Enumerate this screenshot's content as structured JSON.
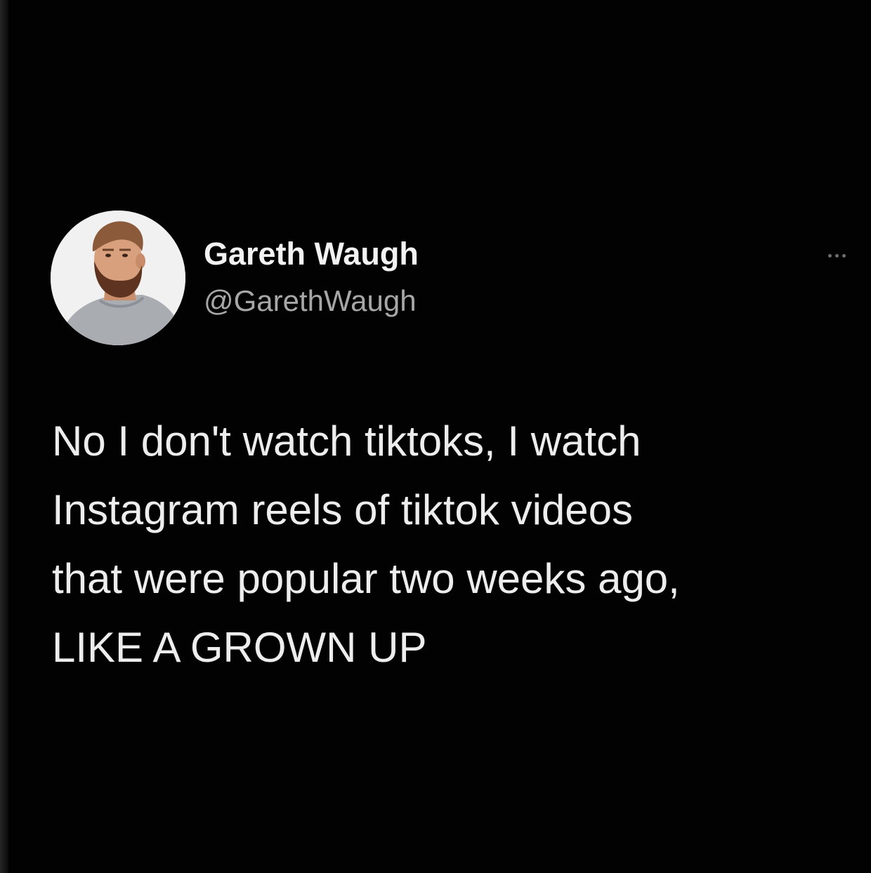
{
  "tweet": {
    "author": {
      "display_name": "Gareth Waugh",
      "handle": "@GarethWaugh",
      "avatar_icon": "profile-photo"
    },
    "more_icon": "ellipsis-icon",
    "text_lines": [
      "No I don't watch tiktoks, I watch",
      "Instagram reels of tiktok videos",
      "that were popular two weeks ago,",
      "LIKE A GROWN UP"
    ]
  },
  "colors": {
    "background": "#000000",
    "name_text": "#f2f2f2",
    "handle_text": "#a7a7a7",
    "body_text": "#ededed"
  }
}
